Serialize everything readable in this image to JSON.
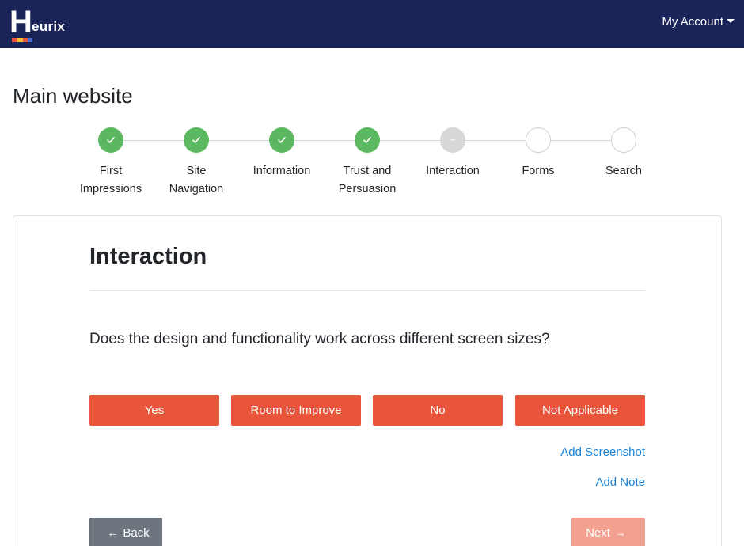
{
  "navbar": {
    "logo_initial": "H",
    "logo_rest": "eurix",
    "account_label": "My Account",
    "background": "#1b2459"
  },
  "page": {
    "title": "Main website"
  },
  "stepper": {
    "steps": [
      {
        "label_line1": "First",
        "label_line2": "Impressions",
        "state": "done"
      },
      {
        "label_line1": "Site",
        "label_line2": "Navigation",
        "state": "done"
      },
      {
        "label_line1": "Information",
        "label_line2": "",
        "state": "done"
      },
      {
        "label_line1": "Trust and",
        "label_line2": "Persuasion",
        "state": "done"
      },
      {
        "label_line1": "Interaction",
        "label_line2": "",
        "state": "current"
      },
      {
        "label_line1": "Forms",
        "label_line2": "",
        "state": "todo"
      },
      {
        "label_line1": "Search",
        "label_line2": "",
        "state": "todo"
      }
    ],
    "current_glyph": "~"
  },
  "section": {
    "title": "Interaction",
    "question": "Does the design and functionality work across different screen sizes?",
    "answers": [
      "Yes",
      "Room to Improve",
      "No",
      "Not Applicable"
    ],
    "add_screenshot": "Add Screenshot",
    "add_note": "Add Note",
    "back_label": "Back",
    "next_label": "Next"
  },
  "colors": {
    "accent": "#e9553a",
    "done": "#5cb860",
    "link": "#1a82d6"
  },
  "icons": {
    "done": "check-icon",
    "back": "arrow-left-icon",
    "next": "arrow-right-icon"
  }
}
